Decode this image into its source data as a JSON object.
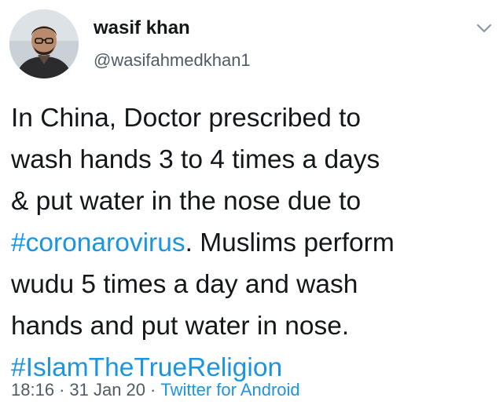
{
  "user": {
    "display_name": "wasif khan",
    "handle": "@wasifahmedkhan1"
  },
  "menu": {
    "caret_icon": "chevron-down-icon"
  },
  "tweet": {
    "line1": "In China, Doctor prescribed to",
    "line2": "wash hands 3 to 4 times a days",
    "line3": "& put water in the nose due to",
    "line4_hashtag": "#coronarovirus",
    "line4_rest": ". Muslims perform",
    "line5": "wudu 5 times a day and wash",
    "line6": "hands and put water in nose.",
    "line7_hashtag": "#IslamTheTrueReligion"
  },
  "meta": {
    "time": "18:16",
    "separator": "·",
    "date": "31 Jan 20",
    "source": "Twitter for Android"
  },
  "colors": {
    "link": "#1b95e0",
    "text": "#14171a",
    "secondary": "#4f5b66"
  }
}
